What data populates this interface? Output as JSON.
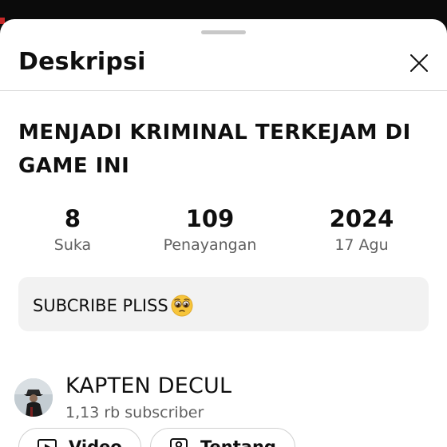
{
  "sheet": {
    "title": "Deskripsi"
  },
  "video": {
    "title": "MENJADI KRIMINAL TERKEJAM DI GAME INI"
  },
  "stats": [
    {
      "value": "8",
      "label": "Suka"
    },
    {
      "value": "109",
      "label": "Penayangan"
    },
    {
      "value": "2024",
      "label": "17 Agu"
    }
  ],
  "description": {
    "text": "SUBCRIBE PLISS",
    "emoji": "pleading-face"
  },
  "channel": {
    "name": "KAPTEN DECUL",
    "subscribers": "1,13 rb subscriber"
  },
  "chips": {
    "video_label": "Video",
    "about_label": "Tentang"
  },
  "colors": {
    "background": "#ffffff",
    "text_primary": "#0f0f0f",
    "text_secondary": "#606060",
    "description_box": "#f2f2f2",
    "top_bar": "#0b0b0b"
  }
}
